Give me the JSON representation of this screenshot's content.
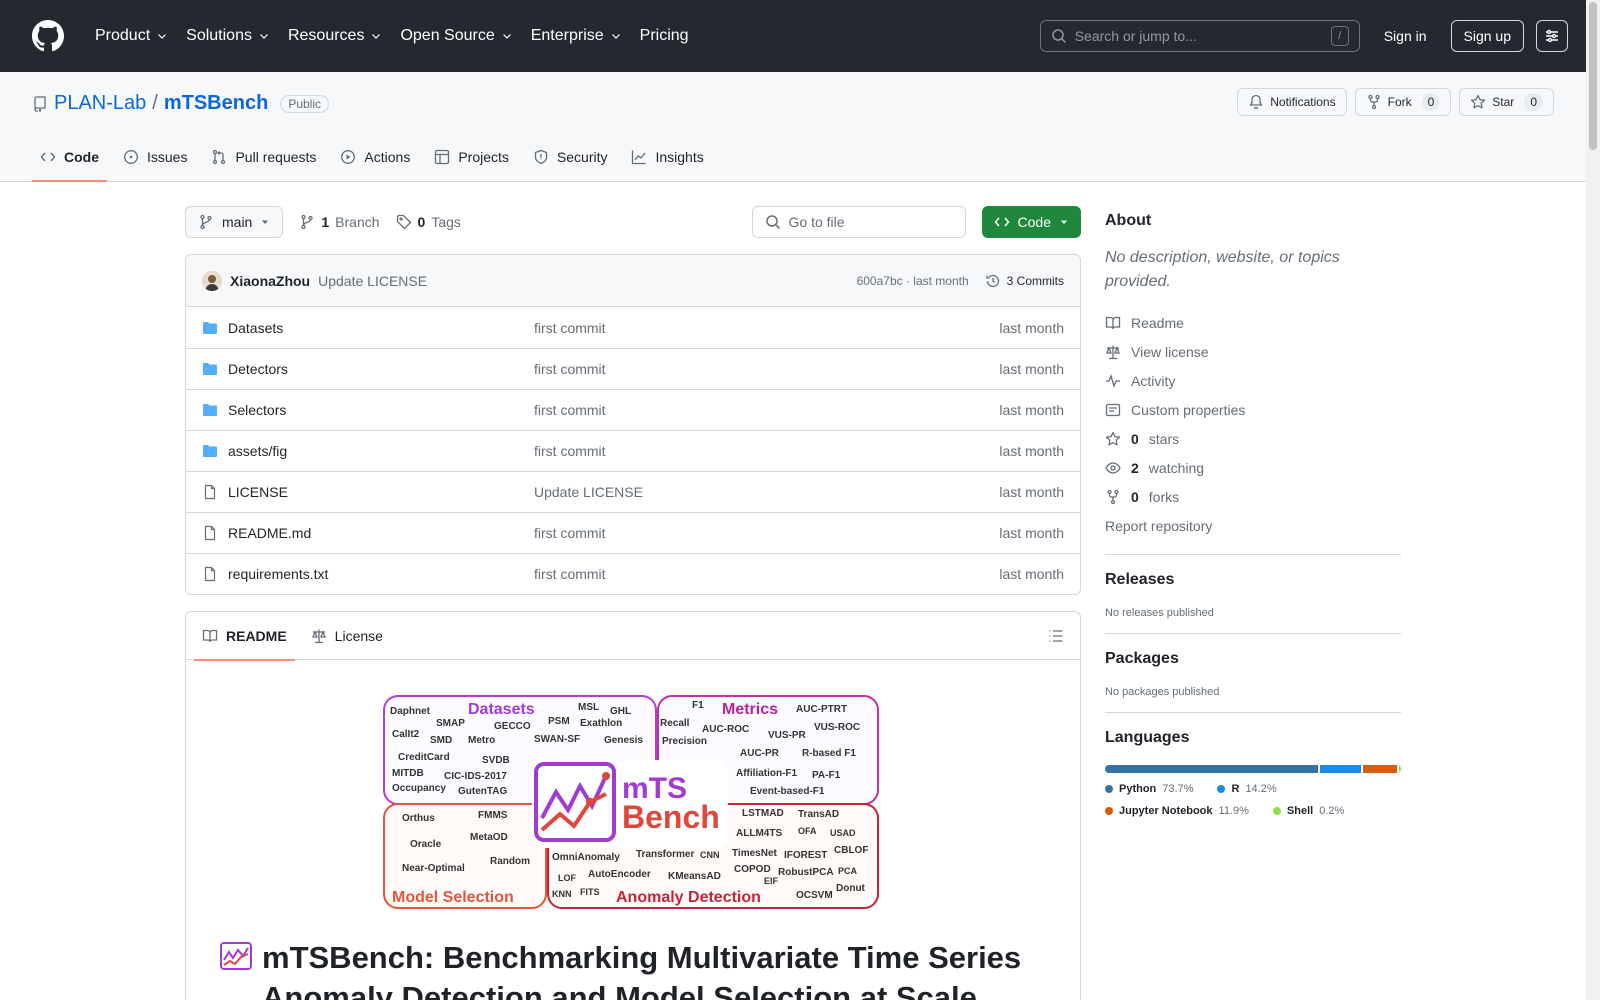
{
  "header": {
    "nav": [
      "Product",
      "Solutions",
      "Resources",
      "Open Source",
      "Enterprise",
      "Pricing"
    ],
    "search_placeholder": "Search or jump to...",
    "search_shortcut": "/",
    "signin": "Sign in",
    "signup": "Sign up"
  },
  "repo": {
    "owner": "PLAN-Lab",
    "separator": "/",
    "name": "mTSBench",
    "visibility": "Public",
    "notifications": "Notifications",
    "fork_label": "Fork",
    "fork_count": "0",
    "star_label": "Star",
    "star_count": "0",
    "tabs": [
      "Code",
      "Issues",
      "Pull requests",
      "Actions",
      "Projects",
      "Security",
      "Insights"
    ]
  },
  "toolbar": {
    "branch": "main",
    "branch_count": "1",
    "branch_label": "Branch",
    "tag_count": "0",
    "tag_label": "Tags",
    "goto_placeholder": "Go to file",
    "code_button": "Code"
  },
  "commit": {
    "author": "XiaonaZhou",
    "message": "Update LICENSE",
    "meta": "600a7bc · last month",
    "commits_label": "3 Commits"
  },
  "files": [
    {
      "name": "Datasets",
      "type": "dir",
      "commit": "first commit",
      "date": "last month"
    },
    {
      "name": "Detectors",
      "type": "dir",
      "commit": "first commit",
      "date": "last month"
    },
    {
      "name": "Selectors",
      "type": "dir",
      "commit": "first commit",
      "date": "last month"
    },
    {
      "name": "assets/fig",
      "type": "dir",
      "commit": "first commit",
      "date": "last month"
    },
    {
      "name": "LICENSE",
      "type": "file",
      "commit": "Update LICENSE",
      "date": "last month"
    },
    {
      "name": "README.md",
      "type": "file",
      "commit": "first commit",
      "date": "last month"
    },
    {
      "name": "requirements.txt",
      "type": "file",
      "commit": "first commit",
      "date": "last month"
    }
  ],
  "readme": {
    "tab_readme": "README",
    "tab_license": "License",
    "title": "mTSBench: Benchmarking Multivariate Time Series Anomaly Detection and Model Selection at Scale",
    "banner": {
      "datasets_label": "Datasets",
      "metrics_label": "Metrics",
      "model_selection_label": "Model Selection",
      "anomaly_detection_label": "Anomaly Detection",
      "logo_line1": "mTS",
      "logo_line2": "Bench",
      "datasets": [
        "Daphnet",
        "SMAP",
        "GECCO",
        "PSM",
        "MSL",
        "GHL",
        "Exathlon",
        "CalIt2",
        "SMD",
        "Metro",
        "SWAN-SF",
        "Genesis",
        "CreditCard",
        "SVDB",
        "MITDB",
        "CIC-IDS-2017",
        "Occupancy",
        "GutenTAG"
      ],
      "metrics": [
        "F1",
        "AUC-PTRT",
        "Recall",
        "VUS-ROC",
        "AUC-ROC",
        "VUS-PR",
        "Precision",
        "AUC-PR",
        "R-based F1",
        "Affiliation-F1",
        "PA-F1",
        "Event-based-F1"
      ],
      "selection": [
        "Orthus",
        "FMMS",
        "Oracle",
        "MetaOD",
        "Random",
        "Near-Optimal"
      ],
      "detection": [
        "LSTMAD",
        "TransAD",
        "ALLM4TS",
        "OFA",
        "USAD",
        "OmniAnomaly",
        "Transformer",
        "CNN",
        "TimesNet",
        "IFOREST",
        "CBLOF",
        "LOF",
        "AutoEncoder",
        "KMeansAD",
        "COPOD",
        "EIF",
        "RobustPCA",
        "PCA",
        "KNN",
        "FITS",
        "OCSVM",
        "Donut"
      ]
    }
  },
  "about": {
    "heading": "About",
    "description": "No description, website, or topics provided.",
    "readme": "Readme",
    "license": "View license",
    "activity": "Activity",
    "custom": "Custom properties",
    "stars_count": "0",
    "stars_label": "stars",
    "watching_count": "2",
    "watching_label": "watching",
    "forks_count": "0",
    "forks_label": "forks",
    "report": "Report repository"
  },
  "releases": {
    "heading": "Releases",
    "empty": "No releases published"
  },
  "packages": {
    "heading": "Packages",
    "empty": "No packages published"
  },
  "languages": {
    "heading": "Languages",
    "items": [
      {
        "name": "Python",
        "pct": "73.7%",
        "value": 73.7,
        "color": "#3572A5"
      },
      {
        "name": "R",
        "pct": "14.2%",
        "value": 14.2,
        "color": "#198CE7"
      },
      {
        "name": "Jupyter Notebook",
        "pct": "11.9%",
        "value": 11.9,
        "color": "#DA5B0B"
      },
      {
        "name": "Shell",
        "pct": "0.2%",
        "value": 0.2,
        "color": "#89e051"
      }
    ]
  }
}
